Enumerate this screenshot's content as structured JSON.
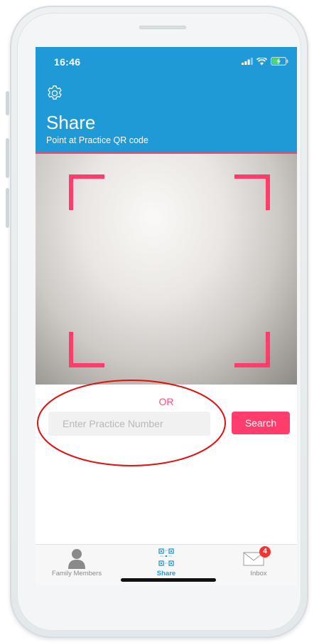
{
  "status_bar": {
    "time": "16:46"
  },
  "header": {
    "title": "Share",
    "subtitle": "Point at Practice QR code",
    "settings_icon": "gear-icon"
  },
  "scanner": {
    "frame_color": "#ff3d6c"
  },
  "manual_entry": {
    "or_label": "OR",
    "input_placeholder": "Enter Practice Number",
    "input_value": "",
    "search_label": "Search"
  },
  "tab_bar": {
    "tabs": [
      {
        "label": "Family Members",
        "icon": "person-icon",
        "active": false
      },
      {
        "label": "Share",
        "icon": "qr-code-icon",
        "active": true
      },
      {
        "label": "Inbox",
        "icon": "envelope-icon",
        "active": false,
        "badge": "4"
      }
    ]
  },
  "colors": {
    "header": "#1f9ad6",
    "accent": "#ff3d6c",
    "badge": "#f2352f",
    "annotation": "#e0120f"
  }
}
